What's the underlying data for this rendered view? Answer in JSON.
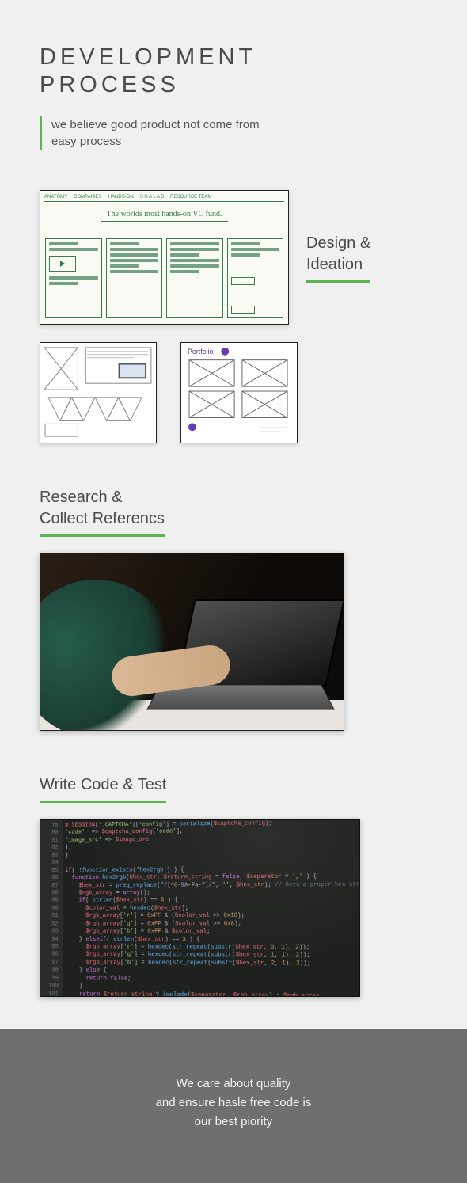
{
  "header": {
    "title_line1": "DEVELOPMENT",
    "title_line2": "PROCESS",
    "tagline": "we believe good product not come from easy process"
  },
  "sections": {
    "design": {
      "heading_line1": "Design &",
      "heading_line2": "Ideation",
      "sketch_topbar": [
        "ANATOMY",
        "COMPANIES",
        "HANDS-ON",
        "S H A L A B",
        "RESOURCE TEAM"
      ],
      "sketch_subtitle": "The worlds most hands-on VC fund.",
      "wireframe2_label": "Portfolio"
    },
    "research": {
      "heading_line1": "Research &",
      "heading_line2": "Collect Referencs"
    },
    "code": {
      "heading": "Write Code & Test",
      "snippet": "$_SESSION['_CAPTCHA']['config'] = serialize($captcha_config);\n'code'  => $captcha_config['code'],\n'image_src' => $image_src\n);\n}\n\nif( !function_exists('hex2rgb') ) {\n  function hex2rgb($hex_str, $return_string = false, $separator = ',' ) {\n    $hex_str = preg_replace(\"/[^0-9A-Fa-f]/\", '', $hex_str); // Gets a proper hex string\n    $rgb_array = array();\n    if( strlen($hex_str) == 6 ) {\n      $color_val = hexdec($hex_str);\n      $rgb_array['r'] = 0xFF & ($color_val >> 0x10);\n      $rgb_array['g'] = 0xFF & ($color_val >> 0x8);\n      $rgb_array['b'] = 0xFF & $color_val;\n    } elseif( strlen($hex_str) == 3 ) {\n      $rgb_array['r'] = hexdec(str_repeat(substr($hex_str, 0, 1), 2));\n      $rgb_array['g'] = hexdec(str_repeat(substr($hex_str, 1, 1), 2));\n      $rgb_array['b'] = hexdec(str_repeat(substr($hex_str, 2, 1), 2));\n    } else {\n      return false;\n    }\n    return $return_string ? implode($separator, $rgb_array) : $rgb_array;\n  }\n}\n// Draw the image"
    }
  },
  "footer": {
    "line1": "We care about quality",
    "line2": "and ensure hasle free code is",
    "line3": "our best piority"
  },
  "colors": {
    "accent": "#5bb54f"
  }
}
